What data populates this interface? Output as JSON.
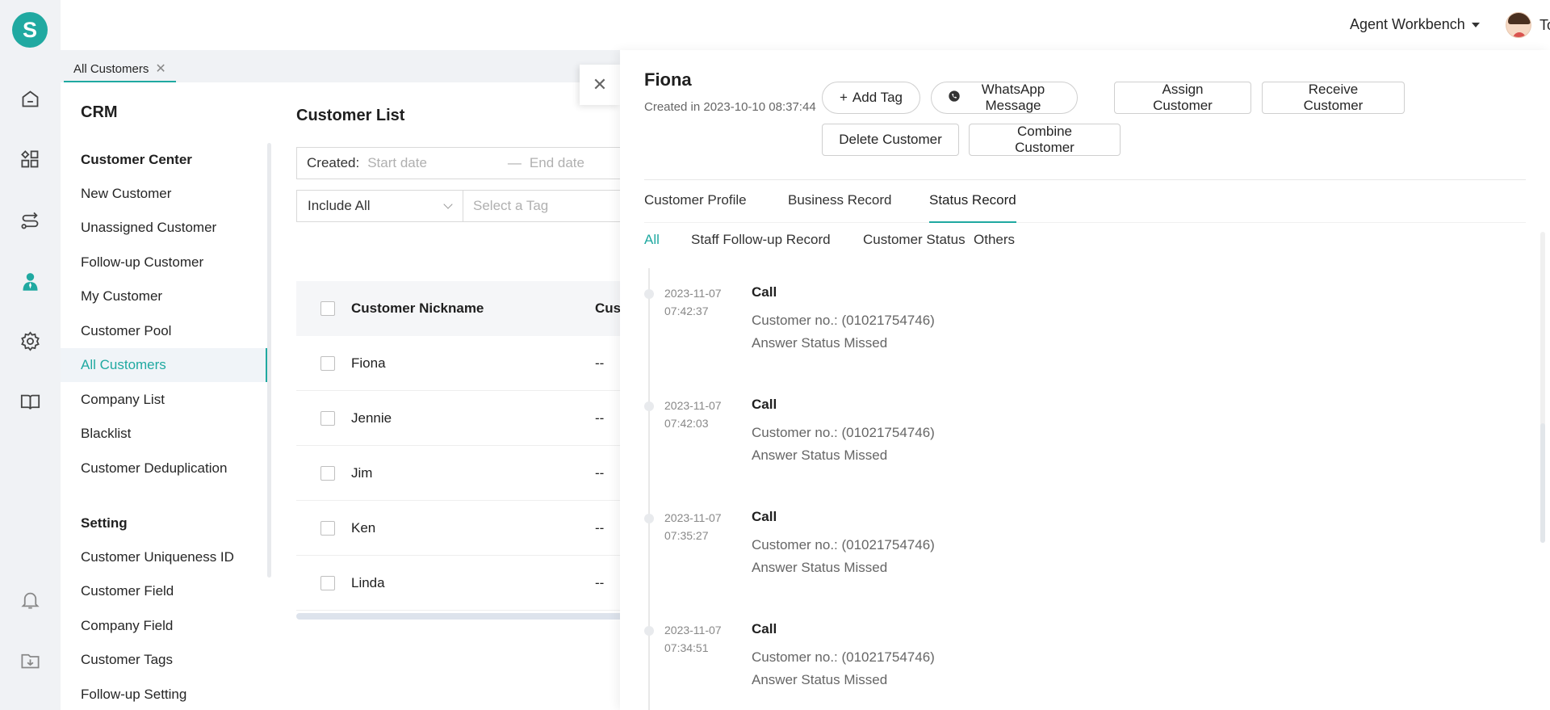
{
  "brand": {
    "logo_letter": "S",
    "accent_color": "#20a9a1"
  },
  "rail": {
    "icons": [
      "home-icon",
      "apps-icon",
      "routing-icon",
      "customer-icon",
      "gear-icon",
      "book-icon",
      "bell-icon",
      "download-icon"
    ],
    "active_icon": "customer-icon"
  },
  "header": {
    "workbench_label": "Agent Workbench",
    "user_name": "Tom"
  },
  "page_tab": {
    "label": "All Customers",
    "close_glyph": "✕"
  },
  "sidebar": {
    "title": "CRM",
    "groups": [
      {
        "title": "Customer Center",
        "items": [
          "New Customer",
          "Unassigned Customer",
          "Follow-up Customer",
          "My Customer",
          "Customer Pool",
          "All Customers",
          "Company List",
          "Blacklist",
          "Customer Deduplication"
        ]
      },
      {
        "title": "Setting",
        "items": [
          "Customer Uniqueness ID",
          "Customer Field",
          "Company Field",
          "Customer Tags",
          "Follow-up Setting"
        ]
      }
    ],
    "active_item": "All Customers"
  },
  "list": {
    "title": "Customer List",
    "created_label": "Created:",
    "start_placeholder": "Start date",
    "range_sep": "—",
    "end_placeholder": "End date",
    "include_select": "Include All",
    "tag_placeholder": "Select a Tag",
    "columns": [
      "Customer Nickname",
      "Cust"
    ],
    "rows": [
      {
        "name": "Fiona",
        "col2": "--"
      },
      {
        "name": "Jennie",
        "col2": "--"
      },
      {
        "name": "Jim",
        "col2": "--"
      },
      {
        "name": "Ken",
        "col2": "--"
      },
      {
        "name": "Linda",
        "col2": "--"
      }
    ]
  },
  "drawer": {
    "close_glyph": "✕",
    "customer_name": "Fiona",
    "created_text": "Created in 2023-10-10 08:37:44",
    "buttons": {
      "add_tag": "Add Tag",
      "whatsapp": "WhatsApp Message",
      "assign": "Assign Customer",
      "receive": "Receive Customer",
      "delete": "Delete Customer",
      "combine": "Combine Customer"
    },
    "main_tabs": [
      "Customer Profile",
      "Business Record",
      "Status Record"
    ],
    "active_main_tab": "Status Record",
    "sub_tabs": [
      "All",
      "Staff Follow-up Record",
      "Customer Status",
      "Others"
    ],
    "active_sub_tab": "All",
    "records": [
      {
        "date": "2023-11-07",
        "time": "07:42:37",
        "title": "Call",
        "line1": "Customer no.:   (01021754746)",
        "line2": "Answer Status Missed"
      },
      {
        "date": "2023-11-07",
        "time": "07:42:03",
        "title": "Call",
        "line1": "Customer no.:   (01021754746)",
        "line2": "Answer Status Missed"
      },
      {
        "date": "2023-11-07",
        "time": "07:35:27",
        "title": "Call",
        "line1": "Customer no.:   (01021754746)",
        "line2": "Answer Status Missed"
      },
      {
        "date": "2023-11-07",
        "time": "07:34:51",
        "title": "Call",
        "line1": "Customer no.:   (01021754746)",
        "line2": "Answer Status Missed"
      }
    ]
  }
}
